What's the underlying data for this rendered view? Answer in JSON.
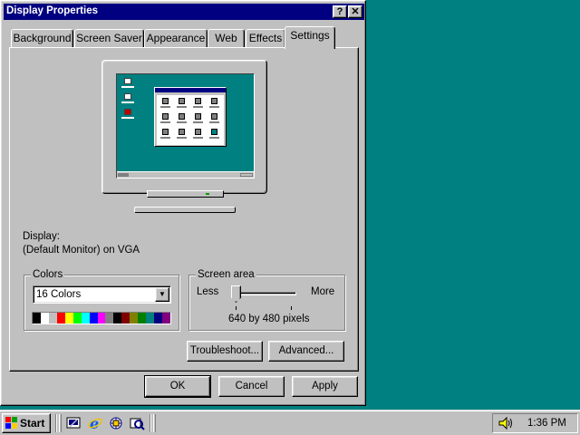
{
  "window": {
    "title": "Display Properties",
    "help_button": "?",
    "close_button": "✕"
  },
  "tabs": [
    {
      "label": "Background"
    },
    {
      "label": "Screen Saver"
    },
    {
      "label": "Appearance"
    },
    {
      "label": "Web"
    },
    {
      "label": "Effects"
    },
    {
      "label": "Settings",
      "active": true
    }
  ],
  "display": {
    "label": "Display:",
    "device": "(Default Monitor) on VGA"
  },
  "colors": {
    "legend": "Colors",
    "selected": "16 Colors",
    "palette": [
      "#000000",
      "#ffffff",
      "#c0c0c0",
      "#ff0000",
      "#ffff00",
      "#00ff00",
      "#00ffff",
      "#0000ff",
      "#ff00ff",
      "#808080",
      "#000000",
      "#800000",
      "#808000",
      "#008000",
      "#008080",
      "#000080",
      "#800080"
    ]
  },
  "screen_area": {
    "legend": "Screen area",
    "less_label": "Less",
    "more_label": "More",
    "resolution": "640 by 480 pixels",
    "slider_position": 0
  },
  "buttons": {
    "troubleshoot": "Troubleshoot...",
    "advanced": "Advanced...",
    "ok": "OK",
    "cancel": "Cancel",
    "apply": "Apply"
  },
  "taskbar": {
    "start_label": "Start",
    "quick_launch": [
      "show-desktop-icon",
      "internet-explorer-icon",
      "channels-icon",
      "outlook-express-icon"
    ],
    "clock": "1:36 PM",
    "tray_icons": [
      "speaker-icon"
    ]
  },
  "colors_theme": {
    "desktop": "#008080",
    "title_bar": "#000080",
    "face": "#c0c0c0"
  }
}
